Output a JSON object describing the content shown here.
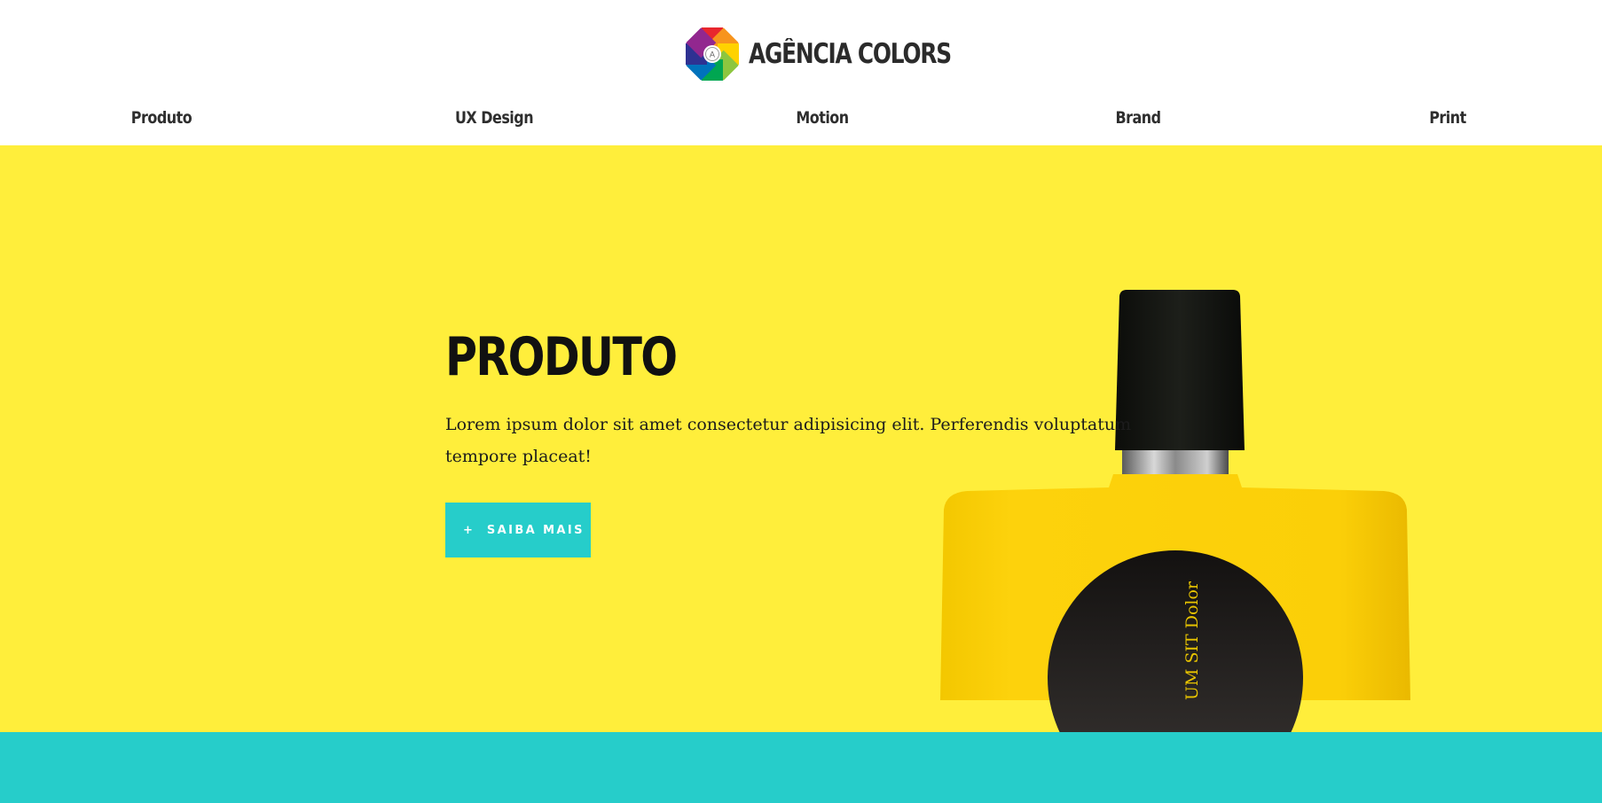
{
  "header": {
    "brand_name": "AGÊNCIA COLORS",
    "logo_letter": "A",
    "nav": [
      "Produto",
      "UX Design",
      "Motion",
      "Brand",
      "Print"
    ]
  },
  "hero": {
    "title": "PRODUTO",
    "text": "Lorem ipsum dolor sit amet consectetur adipisicing elit. Perferendis voluptatum tempore placeat!",
    "button_icon": "+",
    "button_label": "SAIBA MAIS",
    "bottle_label": "UM SIT Dolor"
  },
  "colors": {
    "hero_bg": "#ffee3b",
    "accent": "#26cdca",
    "bottle_yellow": "#fdd00c",
    "cap": "#141611"
  }
}
